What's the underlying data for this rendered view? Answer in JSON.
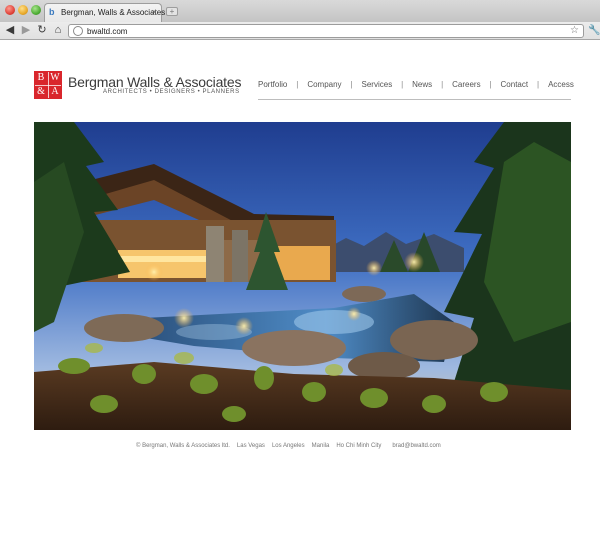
{
  "browser": {
    "tab_title": "Bergman, Walls & Associates",
    "tab_favicon": "bwa-favicon",
    "tab_close": "×",
    "new_tab": "+",
    "url": "bwaltd.com",
    "icons": {
      "back": "arrow-left-icon",
      "forward": "arrow-right-icon",
      "reload": "reload-icon",
      "home": "home-icon",
      "bookmark": "star-icon",
      "settings": "wrench-icon"
    }
  },
  "logo": {
    "letters": [
      "B",
      "W",
      "&",
      "A"
    ],
    "color": "#d9262c",
    "name": "Bergman Walls & Associates",
    "tagline": "ARCHITECTS • DESIGNERS • PLANNERS"
  },
  "nav": {
    "items": [
      "Portfolio",
      "Company",
      "Services",
      "News",
      "Careers",
      "Contact",
      "Access"
    ],
    "separator": "|"
  },
  "hero": {
    "icon": "resort-photo"
  },
  "footer": {
    "copyright": "© Bergman, Walls & Associates ltd.",
    "cities": [
      "Las Vegas",
      "Los Angeles",
      "Manila",
      "Ho Chi Minh City"
    ],
    "email": "brad@bwaltd.com"
  }
}
